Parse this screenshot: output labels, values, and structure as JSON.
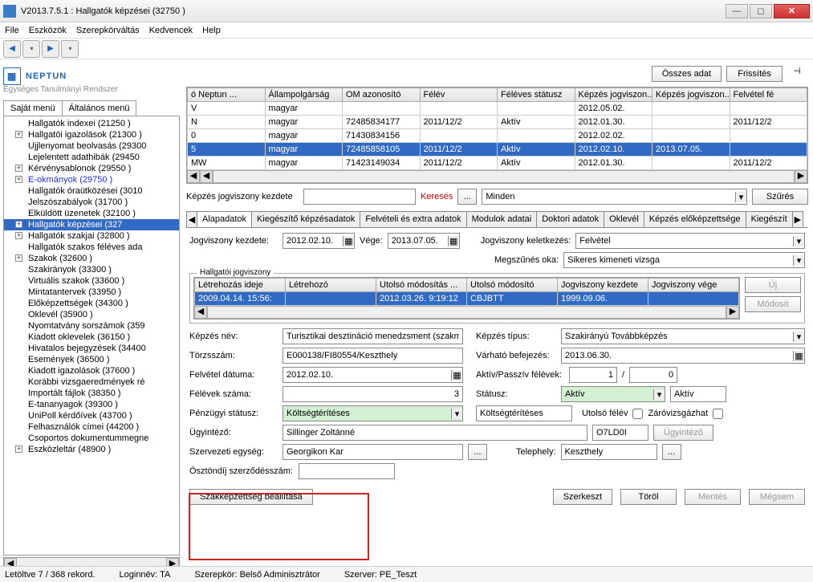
{
  "window": {
    "title": "V2013.7.5.1 : Hallgatók képzései (32750  )"
  },
  "menu": [
    "File",
    "Eszközök",
    "Szerepkörváltás",
    "Kedvencek",
    "Help"
  ],
  "logo": {
    "name": "NEPTUN",
    "sub": "Egységes Tanulmányi Rendszer"
  },
  "leftTabs": {
    "a": "Saját menü",
    "b": "Általános menü"
  },
  "tree": [
    {
      "label": "Hallgatók indexei (21250  )",
      "pad": 1,
      "tg": ""
    },
    {
      "label": "Hallgatói igazolások (21300  )",
      "pad": 1,
      "tg": "+"
    },
    {
      "label": "Ujjlenyomat beolvasás (29300",
      "pad": 1,
      "tg": ""
    },
    {
      "label": "Lejelentett adathibák (29450",
      "pad": 1,
      "tg": ""
    },
    {
      "label": "Kérvénysablonok (29550  )",
      "pad": 1,
      "tg": "+"
    },
    {
      "label": "E-okmányok (29750  )",
      "pad": 1,
      "tg": "+",
      "blue": true
    },
    {
      "label": "Hallgatók óraütközései (3010",
      "pad": 1,
      "tg": ""
    },
    {
      "label": "Jelszószabályok (31700  )",
      "pad": 1,
      "tg": ""
    },
    {
      "label": "Elküldött üzenetek (32100  )",
      "pad": 1,
      "tg": ""
    },
    {
      "label": "Hallgatók képzései (327",
      "pad": 1,
      "tg": "+",
      "sel": true
    },
    {
      "label": "Hallgatók szakjai (32800  )",
      "pad": 1,
      "tg": "+"
    },
    {
      "label": "Hallgatók szakos féléves ada",
      "pad": 1,
      "tg": ""
    },
    {
      "label": "Szakok (32600  )",
      "pad": 1,
      "tg": "+"
    },
    {
      "label": "Szakirányok (33300  )",
      "pad": 1,
      "tg": ""
    },
    {
      "label": "Virtuális szakok (33600  )",
      "pad": 1,
      "tg": ""
    },
    {
      "label": "Mintatantervek (33950  )",
      "pad": 1,
      "tg": ""
    },
    {
      "label": "Előképzettségek (34300  )",
      "pad": 1,
      "tg": ""
    },
    {
      "label": "Oklevél (35900  )",
      "pad": 1,
      "tg": ""
    },
    {
      "label": "Nyomtatvány sorszámok (359",
      "pad": 1,
      "tg": ""
    },
    {
      "label": "Kiadott oklevelek (36150  )",
      "pad": 1,
      "tg": ""
    },
    {
      "label": "Hivatalos bejegyzések (34400",
      "pad": 1,
      "tg": ""
    },
    {
      "label": "Események (36500  )",
      "pad": 1,
      "tg": ""
    },
    {
      "label": "Kiadott igazolások (37600  )",
      "pad": 1,
      "tg": ""
    },
    {
      "label": "Korábbi vizsgaeredmények ré",
      "pad": 1,
      "tg": ""
    },
    {
      "label": "Importált fájlok (38350  )",
      "pad": 1,
      "tg": ""
    },
    {
      "label": "E-tananyagok (39300  )",
      "pad": 1,
      "tg": ""
    },
    {
      "label": "UniPoll kérdőívek (43700  )",
      "pad": 1,
      "tg": ""
    },
    {
      "label": "Felhasználók címei (44200  )",
      "pad": 1,
      "tg": ""
    },
    {
      "label": "Csoportos dokumentummegne",
      "pad": 1,
      "tg": ""
    },
    {
      "label": "Eszközleltár (48900  )",
      "pad": 1,
      "tg": "+"
    }
  ],
  "topbtns": {
    "all": "Összes adat",
    "refresh": "Frissítés"
  },
  "gridCols": [
    "ó Neptun ...",
    "Állampolgárság",
    "OM azonosító",
    "Félév",
    "Féléves státusz",
    "Képzés jogviszon...",
    "Képzés jogviszon...",
    "Felvétel fé"
  ],
  "gridRows": [
    [
      "V",
      "magyar",
      "",
      "",
      "",
      "2012.05.02.",
      "",
      ""
    ],
    [
      "N",
      "magyar",
      "72485834177",
      "2011/12/2",
      "Aktív",
      "2012.01.30.",
      "",
      "2011/12/2"
    ],
    [
      "0",
      "magyar",
      "71430834156",
      "",
      "",
      "2012.02.02.",
      "",
      ""
    ],
    [
      "5",
      "magyar",
      "72485858105",
      "2011/12/2",
      "Aktív",
      "2012.02.10.",
      "2013.07.05.",
      ""
    ],
    [
      "MW",
      "magyar",
      "71423149034",
      "2011/12/2",
      "Aktív",
      "2012.01.30.",
      "",
      "2011/12/2"
    ]
  ],
  "gridSel": 3,
  "search": {
    "lbl": "Képzés jogviszony kezdete",
    "btn": "Keresés",
    "dots": "...",
    "combo": "Minden",
    "flt": "Szűrés"
  },
  "tabs": [
    "Alapadatok",
    "Kiegészítő képzésadatok",
    "Felvételi és extra adatok",
    "Modulok adatai",
    "Doktori adatok",
    "Oklevél",
    "Képzés előképzettsége",
    "Kiegészít"
  ],
  "form": {
    "jk_lbl": "Jogviszony kezdete:",
    "jk_val": "2012.02.10.",
    "vege_lbl": "Vége:",
    "vege_val": "2013.07.05.",
    "jkk_lbl": "Jogviszony keletkezés:",
    "jkk_val": "Felvétel",
    "mo_lbl": "Megszűnés oka:",
    "mo_val": "Sikeres kimeneti vizsga",
    "hj_title": "Hallgatói jogviszony",
    "hj_cols": [
      "Létrehozás ideje",
      "Létrehozó",
      "Utolsó módosítás ...",
      "Utolsó módosító",
      "Jogviszony kezdete",
      "Jogviszony vége"
    ],
    "hj_row": [
      "2009.04.14. 15:56:",
      "",
      "2012.03.26. 9:19:12",
      "CBJBTT",
      "1999.09.06.",
      ""
    ],
    "uj": "Új",
    "mod": "Módosít",
    "kn_lbl": "Képzés név:",
    "kn_val": "Turisztikai desztináció menedzsment (szakmé",
    "kt_lbl": "Képzés típus:",
    "kt_val": "Szakirányú Továbbképzés",
    "ts_lbl": "Törzsszám:",
    "ts_val": "E000138/FI80554/Keszthely",
    "vb_lbl": "Várható befejezés:",
    "vb_val": "2013.06.30.",
    "fd_lbl": "Felvétel dátuma:",
    "fd_val": "2012.02.10.",
    "ap_lbl": "Aktív/Passzív félévek:",
    "ap1": "1",
    "ap2": "0",
    "fs_lbl": "Félévek száma:",
    "fs_val": "3",
    "st_lbl": "Státusz:",
    "st_val": "Aktív",
    "st2": "Aktív",
    "ps_lbl": "Pénzügyi státusz:",
    "ps_val": "Költségtérítéses",
    "ps2": "Költségtérítéses",
    "uf_lbl": "Utolsó félév",
    "zv_lbl": "Záróvizsgázhat",
    "ui_lbl": "Ügyintéző:",
    "ui_val": "Sillinger Zoltánné",
    "ui_code": "O7LD0I",
    "ui_btn": "Ügyintéző",
    "se_lbl": "Szervezeti egység:",
    "se_val": "Georgikon Kar",
    "te_lbl": "Telephely:",
    "te_val": "Keszthely",
    "os_lbl": "Ösztöndíj szerződésszám:"
  },
  "bottomBtns": {
    "szak": "Szakképzettség beállítása",
    "szerk": "Szerkeszt",
    "torol": "Töröl",
    "mentes": "Mentés",
    "megsem": "Mégsem"
  },
  "status": {
    "records": "Letöltve 7 / 368 rekord.",
    "login": "Loginnév: TA",
    "szerep": "Szerepkör: Belső Adminisztrátor",
    "szerver": "Szerver: PE_Teszt"
  }
}
